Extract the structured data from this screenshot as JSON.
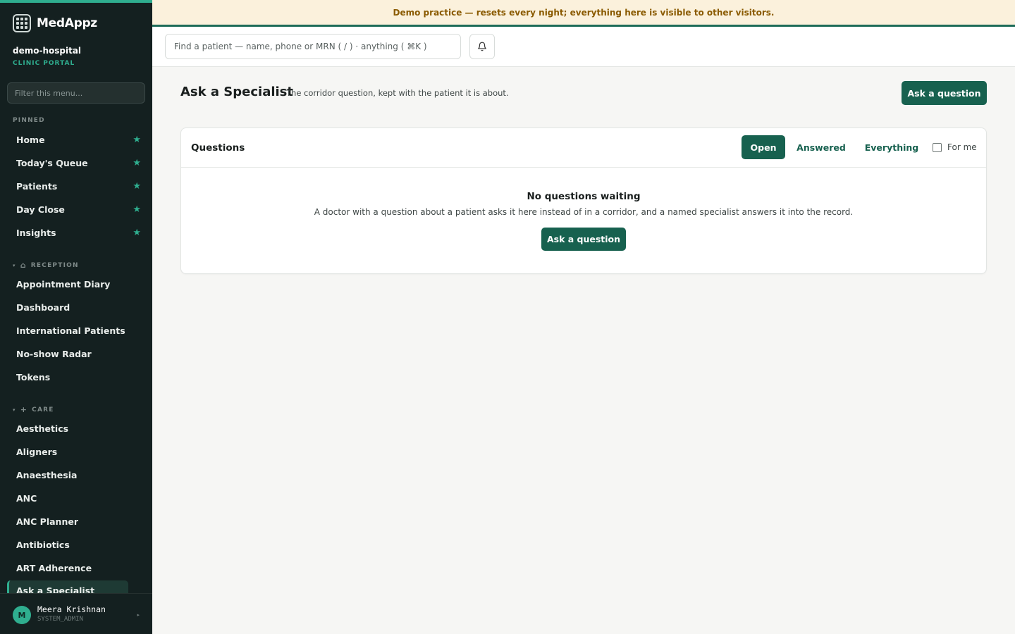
{
  "brand": {
    "name": "MedAppz"
  },
  "org": {
    "name": "demo-hospital",
    "subtitle": "CLINIC PORTAL"
  },
  "sidebar": {
    "filter_placeholder": "Filter this menu...",
    "pinned_label": "PINNED",
    "pinned": [
      {
        "label": "Home"
      },
      {
        "label": "Today's Queue"
      },
      {
        "label": "Patients"
      },
      {
        "label": "Day Close"
      },
      {
        "label": "Insights"
      }
    ],
    "reception_label": "RECEPTION",
    "reception": [
      {
        "label": "Appointment Diary"
      },
      {
        "label": "Dashboard"
      },
      {
        "label": "International Patients"
      },
      {
        "label": "No-show Radar"
      },
      {
        "label": "Tokens"
      }
    ],
    "care_label": "CARE",
    "care": [
      {
        "label": "Aesthetics"
      },
      {
        "label": "Aligners"
      },
      {
        "label": "Anaesthesia"
      },
      {
        "label": "ANC"
      },
      {
        "label": "ANC Planner"
      },
      {
        "label": "Antibiotics"
      },
      {
        "label": "ART Adherence"
      },
      {
        "label": "Ask a Specialist"
      }
    ]
  },
  "user": {
    "initial": "M",
    "name": "Meera Krishnan",
    "role": "SYSTEM_ADMIN"
  },
  "banner": {
    "text": "Demo practice — resets every night; everything here is visible to other visitors."
  },
  "topbar": {
    "search_placeholder": "Find a patient — name, phone or MRN ( / ) · anything ( ⌘K )"
  },
  "page": {
    "title": "Ask a Specialist",
    "subtitle": "The corridor question, kept with the patient it is about.",
    "ask_button": "Ask a question"
  },
  "questions": {
    "title": "Questions",
    "filters": [
      "Open",
      "Answered",
      "Everything"
    ],
    "for_me_label": "For me",
    "empty_title": "No questions waiting",
    "empty_desc": "A doctor with a question about a patient asks it here instead of in a corridor, and a named specialist answers it into the record.",
    "empty_button": "Ask a question"
  },
  "colors": {
    "accent": "#17614f",
    "sidebar_bg": "#142020",
    "banner_bg": "#fbf1dc",
    "banner_text": "#8a5a00"
  }
}
